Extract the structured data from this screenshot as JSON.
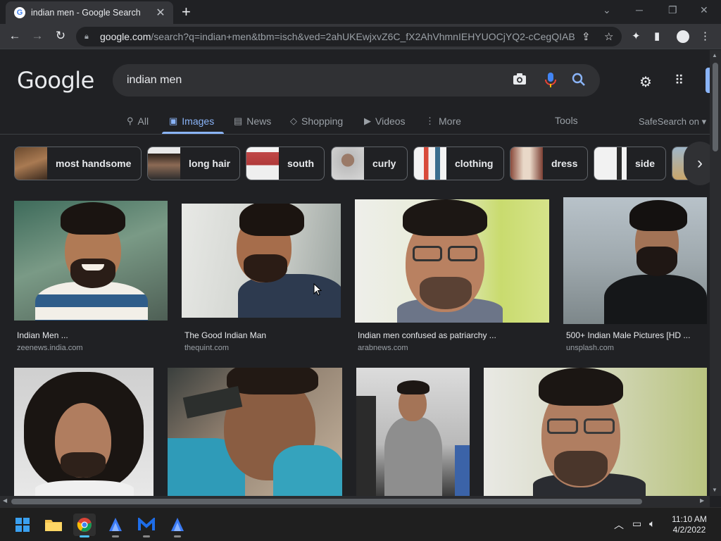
{
  "browser": {
    "tab_title": "indian men - Google Search",
    "tab_favicon": "G",
    "url_host": "google.com",
    "url_path": "/search?q=indian+men&tbm=isch&ved=2ahUKEwjxvZ6C_fX2AhVhmnIEHYUOCjYQ2-cCegQIAB..."
  },
  "google": {
    "logo": "Google",
    "query": "indian men",
    "nav": [
      {
        "label": "All",
        "icon": "search-icon"
      },
      {
        "label": "Images",
        "icon": "image-icon"
      },
      {
        "label": "News",
        "icon": "news-icon"
      },
      {
        "label": "Shopping",
        "icon": "tag-icon"
      },
      {
        "label": "Videos",
        "icon": "play-icon"
      },
      {
        "label": "More",
        "icon": "kebab-icon"
      }
    ],
    "tools": "Tools",
    "safesearch": "SafeSearch on",
    "chips": [
      {
        "label": "most handsome"
      },
      {
        "label": "long hair"
      },
      {
        "label": "south"
      },
      {
        "label": "curly"
      },
      {
        "label": "clothing"
      },
      {
        "label": "dress"
      },
      {
        "label": "side"
      }
    ],
    "results": [
      {
        "caption": "Indian Men ...",
        "source": "zeenews.india.com"
      },
      {
        "caption": "The Good Indian Man",
        "source": "thequint.com"
      },
      {
        "caption": "Indian men confused as patriarchy ...",
        "source": "arabnews.com"
      },
      {
        "caption": "500+ Indian Male Pictures [HD ...",
        "source": "unsplash.com"
      }
    ]
  },
  "taskbar": {
    "time": "11:10 AM",
    "date": "4/2/2022"
  },
  "colors": {
    "background": "#202124",
    "accent": "#8ab4f8",
    "text": "#e8eaed",
    "muted": "#9aa0a6"
  }
}
